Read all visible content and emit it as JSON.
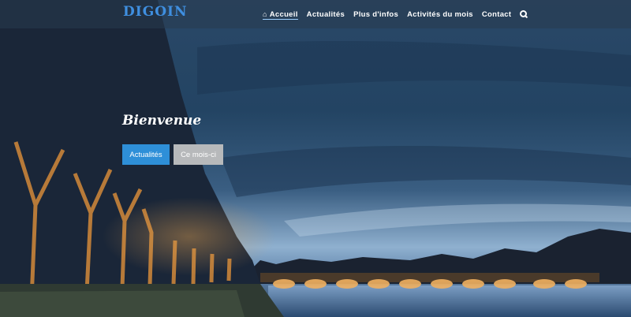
{
  "brand": {
    "title": "DIGOIN"
  },
  "nav": {
    "items": [
      {
        "label": "Accueil",
        "icon": "home-icon",
        "active": true
      },
      {
        "label": "Actualités"
      },
      {
        "label": "Plus d'infos"
      },
      {
        "label": "Activités du mois"
      },
      {
        "label": "Contact"
      }
    ],
    "search_icon": "search-icon"
  },
  "hero": {
    "title": "Bienvenue",
    "buttons": {
      "primary": "Actualités",
      "secondary": "Ce mois-ci"
    }
  },
  "colors": {
    "brand": "#3f8fe0",
    "primary_button": "#2e8fd8",
    "secondary_button": "#b7b9bb",
    "navbar": "#283a4e"
  }
}
